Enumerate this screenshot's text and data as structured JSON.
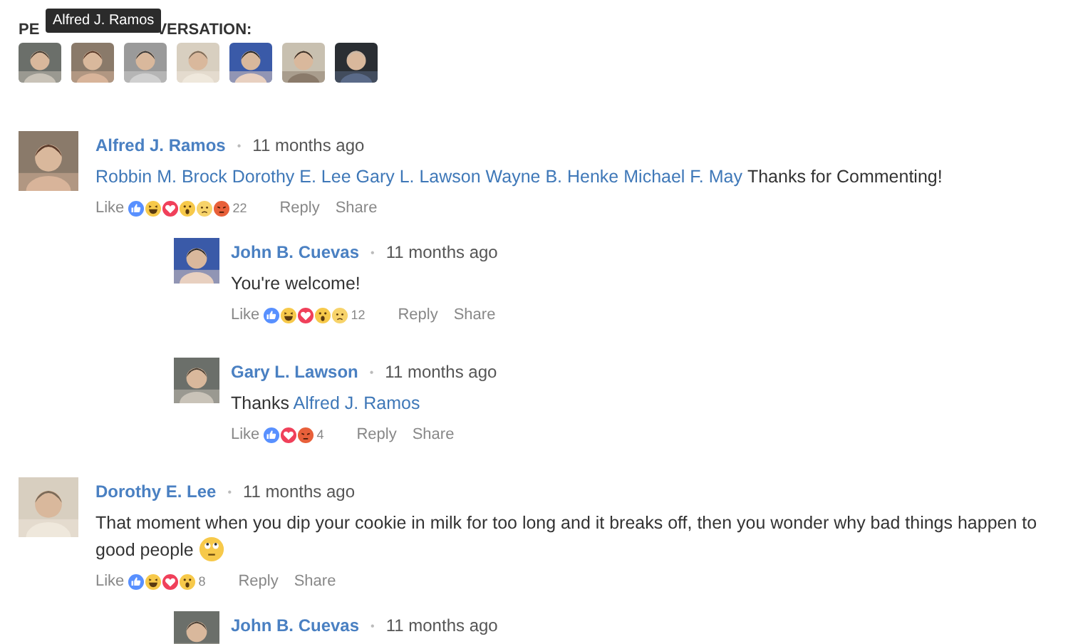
{
  "people_in_conversation": {
    "heading_start": "PE",
    "heading_end": "VERSATION:",
    "tooltip": "Alfred J. Ramos"
  },
  "comments": [
    {
      "author": "Alfred J. Ramos",
      "separator": "•",
      "time": "11 months ago",
      "body": [
        {
          "kind": "mention",
          "text": "Robbin M. Brock"
        },
        {
          "kind": "mention",
          "text": "Dorothy E. Lee"
        },
        {
          "kind": "mention",
          "text": "Gary L. Lawson"
        },
        {
          "kind": "mention",
          "text": "Wayne B. Henke"
        },
        {
          "kind": "mention",
          "text": "Michael F. May"
        },
        {
          "kind": "text",
          "text": "Thanks for Commenting!"
        }
      ],
      "like": "Like",
      "reactions": [
        {
          "kind": "like"
        },
        {
          "kind": "haha"
        },
        {
          "kind": "love"
        },
        {
          "kind": "wow"
        },
        {
          "kind": "sad"
        },
        {
          "kind": "angry"
        }
      ],
      "count": "22",
      "reply": "Reply",
      "share": "Share",
      "children": [
        {
          "author": "John B. Cuevas",
          "separator": "•",
          "time": "11 months ago",
          "body": [
            {
              "kind": "text",
              "text": "You're welcome!"
            }
          ],
          "like": "Like",
          "reactions": [
            {
              "kind": "like"
            },
            {
              "kind": "haha"
            },
            {
              "kind": "love"
            },
            {
              "kind": "wow"
            },
            {
              "kind": "sad"
            }
          ],
          "count": "12",
          "reply": "Reply",
          "share": "Share"
        },
        {
          "author": "Gary L. Lawson",
          "separator": "•",
          "time": "11 months ago",
          "body": [
            {
              "kind": "text",
              "text": "Thanks"
            },
            {
              "kind": "mention",
              "text": "Alfred J. Ramos"
            }
          ],
          "like": "Like",
          "reactions": [
            {
              "kind": "like"
            },
            {
              "kind": "love"
            },
            {
              "kind": "angry"
            }
          ],
          "count": "4",
          "reply": "Reply",
          "share": "Share"
        }
      ]
    },
    {
      "author": "Dorothy E. Lee",
      "separator": "•",
      "time": "11 months ago",
      "body": [
        {
          "kind": "text",
          "text": "That moment when you dip your cookie in milk for too long and it breaks off, then you wonder why bad things happen to"
        },
        {
          "kind": "text",
          "text": "good people"
        },
        {
          "kind": "emoji"
        }
      ],
      "like": "Like",
      "reactions": [
        {
          "kind": "like"
        },
        {
          "kind": "haha"
        },
        {
          "kind": "love"
        },
        {
          "kind": "wow"
        }
      ],
      "count": "8",
      "reply": "Reply",
      "share": "Share",
      "children": [
        {
          "author": "John B. Cuevas",
          "separator": "•",
          "time": "11 months ago"
        }
      ]
    }
  ]
}
